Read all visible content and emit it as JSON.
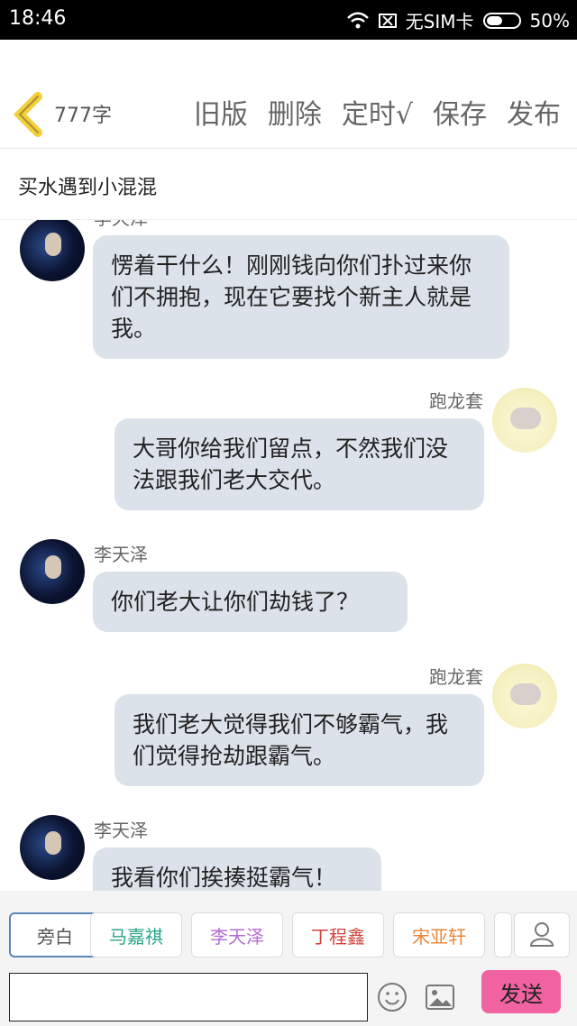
{
  "status_bar": {
    "time": "18:46",
    "sim": "无SIM卡",
    "battery": "50%"
  },
  "toolbar": {
    "word_count": "777字",
    "actions": [
      "旧版",
      "删除",
      "定时√",
      "保存",
      "发布"
    ]
  },
  "story_title": "买水遇到小混混",
  "messages": [
    {
      "side": "left",
      "name": "李天泽",
      "text": "愣着干什么！刚刚钱向你们扑过来你们不拥抱，现在它要找个新主人就是我。"
    },
    {
      "side": "right",
      "name": "跑龙套",
      "text": "大哥你给我们留点，不然我们没法跟我们老大交代。"
    },
    {
      "side": "left",
      "name": "李天泽",
      "text": "你们老大让你们劫钱了？"
    },
    {
      "side": "right",
      "name": "跑龙套",
      "text": "我们老大觉得我们不够霸气，我们觉得抢劫跟霸气。"
    },
    {
      "side": "left",
      "name": "李天泽",
      "text": "我看你们挨揍挺霸气！"
    }
  ],
  "characters": [
    {
      "label": "旁白",
      "color": "#666666"
    },
    {
      "label": "马嘉祺",
      "color": "#2aa58a"
    },
    {
      "label": "李天泽",
      "color": "#b16bd2"
    },
    {
      "label": "丁程鑫",
      "color": "#d0433a"
    },
    {
      "label": "宋亚轩",
      "color": "#e8863a"
    }
  ],
  "send_label": "发送",
  "icons": {
    "back": "chevron-left-icon",
    "wifi": "wifi-icon",
    "sim": "no-sim-icon",
    "battery": "battery-icon",
    "user": "user-icon",
    "emoji": "smile-icon",
    "image": "image-icon"
  },
  "accent": {
    "back": "#f3cf3a",
    "send": "#f062a0"
  }
}
